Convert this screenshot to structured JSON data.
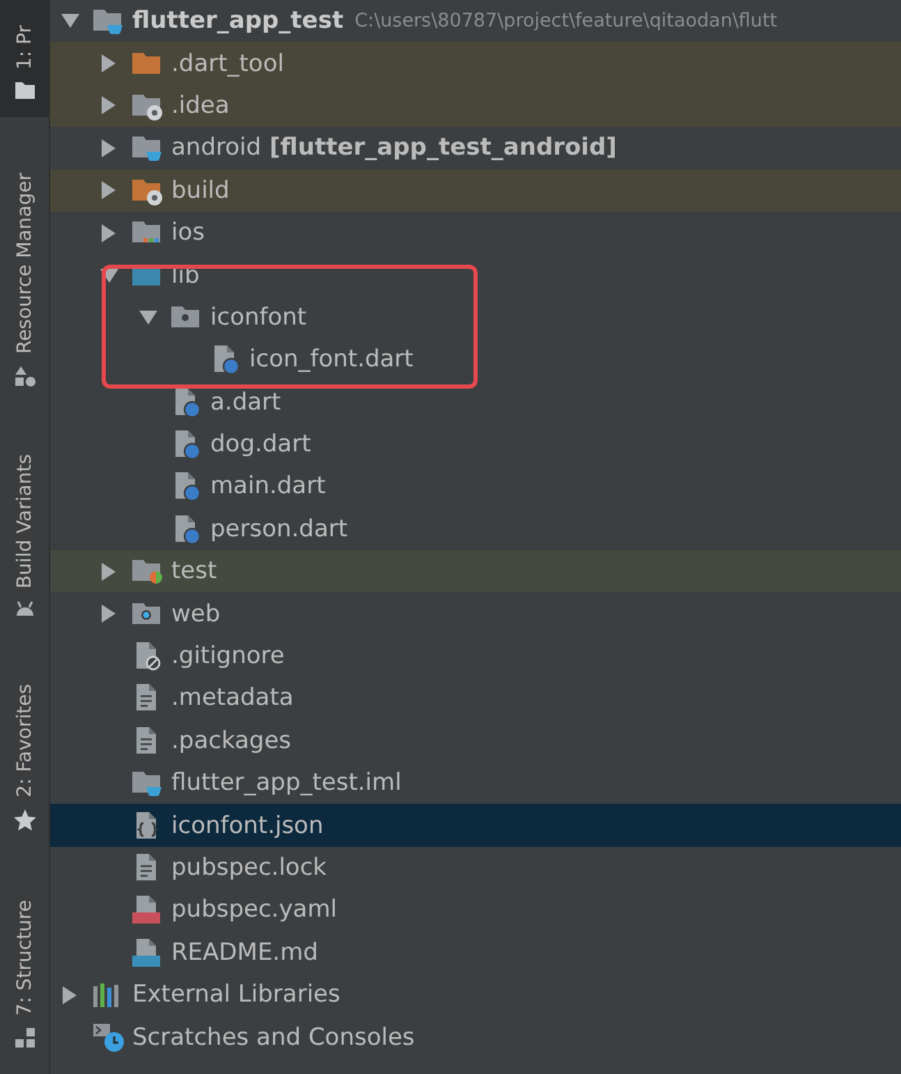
{
  "side_tabs": [
    {
      "label": "1: Pr",
      "kind": "folder",
      "selected": true
    },
    {
      "label": "Resource Manager",
      "kind": "shapes",
      "selected": false
    },
    {
      "label": "Build Variants",
      "kind": "android",
      "selected": false
    },
    {
      "label": "2: Favorites",
      "kind": "star",
      "selected": false
    },
    {
      "label": "7: Structure",
      "kind": "structure",
      "selected": false
    }
  ],
  "tree": [
    {
      "name": "flutter_app_test",
      "path": "C:\\users\\80787\\project\\feature\\qitaodan\\flutt",
      "kind": "folder-module",
      "expanded": true,
      "selected": false,
      "children": [
        {
          "name": ".dart_tool",
          "kind": "folder-orange",
          "expanded": false,
          "selected": false,
          "color": "#49473a"
        },
        {
          "name": ".idea",
          "kind": "folder-gear",
          "expanded": false,
          "selected": false,
          "color": "#49473a"
        },
        {
          "name": "android",
          "module": "[flutter_app_test_android]",
          "kind": "folder-module",
          "expanded": false,
          "selected": false
        },
        {
          "name": "build",
          "kind": "folder-gear-orange",
          "expanded": false,
          "selected": false,
          "color": "#49473a"
        },
        {
          "name": "ios",
          "kind": "folder-ios",
          "expanded": false,
          "selected": false
        },
        {
          "name": "lib",
          "kind": "folder-source",
          "expanded": true,
          "selected": false,
          "children": [
            {
              "name": "iconfont",
              "kind": "folder-package",
              "expanded": true,
              "selected": false,
              "annotated": true,
              "children": [
                {
                  "name": "icon_font.dart",
                  "kind": "dart",
                  "selected": false
                }
              ]
            },
            {
              "name": "a.dart",
              "kind": "dart",
              "selected": false
            },
            {
              "name": "dog.dart",
              "kind": "dart",
              "selected": false
            },
            {
              "name": "main.dart",
              "kind": "dart",
              "selected": false
            },
            {
              "name": "person.dart",
              "kind": "dart",
              "selected": false
            }
          ]
        },
        {
          "name": "test",
          "kind": "folder-test",
          "expanded": false,
          "selected": false,
          "color": "#454a40"
        },
        {
          "name": "web",
          "kind": "folder-web",
          "expanded": false,
          "selected": false
        },
        {
          "name": ".gitignore",
          "kind": "gitignore",
          "selected": false
        },
        {
          "name": ".metadata",
          "kind": "text",
          "selected": false
        },
        {
          "name": ".packages",
          "kind": "text",
          "selected": false
        },
        {
          "name": "flutter_app_test.iml",
          "kind": "folder-module",
          "selected": false
        },
        {
          "name": "iconfont.json",
          "kind": "json",
          "selected": true
        },
        {
          "name": "pubspec.lock",
          "kind": "text",
          "selected": false
        },
        {
          "name": "pubspec.yaml",
          "kind": "yaml",
          "selected": false
        },
        {
          "name": "README.md",
          "kind": "md",
          "selected": false
        }
      ]
    },
    {
      "name": "External Libraries",
      "kind": "libraries",
      "expanded": false,
      "selected": false
    },
    {
      "name": "Scratches and Consoles",
      "kind": "scratches",
      "selected": false
    }
  ]
}
